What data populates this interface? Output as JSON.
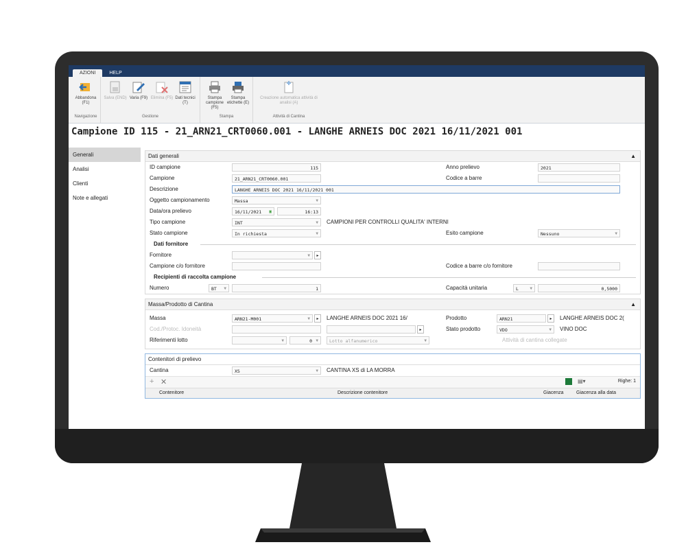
{
  "ribbon": {
    "tabs": [
      "AZIONI",
      "HELP"
    ],
    "groups": [
      {
        "name": "Navigazione",
        "buttons": [
          {
            "label": "Abbandona (F1)",
            "icon": "exit-arrow-icon"
          }
        ]
      },
      {
        "name": "Gestione",
        "buttons": [
          {
            "label": "Salva (END)",
            "icon": "save-icon"
          },
          {
            "label": "Varia (F9)",
            "icon": "edit-icon"
          },
          {
            "label": "Elimina (F5)",
            "icon": "delete-icon"
          },
          {
            "label": "Dati tecnici (T)",
            "icon": "technical-data-icon"
          }
        ]
      },
      {
        "name": "Stampa",
        "buttons": [
          {
            "label": "Stampa campione (F5)",
            "icon": "print-icon"
          },
          {
            "label": "Stampa etichette (E)",
            "icon": "print-labels-icon"
          }
        ]
      },
      {
        "name": "Attività di Cantina",
        "buttons": [
          {
            "label": "Creazione automatica attività di analisi (A)",
            "icon": "auto-create-icon"
          }
        ]
      }
    ]
  },
  "title": "Campione  ID 115 - 21_ARN21_CRT0060.001 - LANGHE ARNEIS DOC 2021 16/11/2021 001",
  "nav": [
    "Generali",
    "Analisi",
    "Clienti",
    "Note e allegati"
  ],
  "dati_generali": {
    "header": "Dati generali",
    "id_label": "ID campione",
    "id_value": "115",
    "anno_label": "Anno prelievo",
    "anno_value": "2021",
    "campione_label": "Campione",
    "campione_value": "21_ARN21_CRT0060.001",
    "barcode_label": "Codice a barre",
    "barcode_value": "",
    "descr_label": "Descrizione",
    "descr_value": "LANGHE ARNEIS DOC 2021 16/11/2021 001",
    "oggetto_label": "Oggetto campionamento",
    "oggetto_value": "Massa",
    "data_label": "Data/ora prelievo",
    "data_value": "16/11/2021",
    "ora_value": "16:13",
    "tipo_label": "Tipo campione",
    "tipo_value": "INT",
    "tipo_desc": "CAMPIONI PER CONTROLLI QUALITA' INTERNI",
    "stato_label": "Stato campione",
    "stato_value": "In richiesta",
    "esito_label": "Esito campione",
    "esito_value": "Nessuno",
    "fornitore_section": "Dati fornitore",
    "fornitore_label": "Fornitore",
    "fornitore_value": "",
    "campione_forn_label": "Campione c/o fornitore",
    "campione_forn_value": "",
    "barcode_forn_label": "Codice a barre c/o fornitore",
    "barcode_forn_value": "",
    "recipienti_section": "Recipienti di raccolta campione",
    "numero_label": "Numero",
    "numero_unit": "BT",
    "numero_value": "1",
    "capacita_label": "Capacità unitaria",
    "capacita_unit": "L",
    "capacita_value": "0,5000"
  },
  "massa": {
    "header": "Massa/Prodotto di Cantina",
    "massa_label": "Massa",
    "massa_value": "ARN21-M001",
    "massa_desc": "LANGHE ARNEIS DOC 2021 16/",
    "prodotto_label": "Prodotto",
    "prodotto_value": "ARN21",
    "prodotto_desc": "LANGHE ARNEIS DOC 2(",
    "cod_label": "Cod./Protoc. Idoneità",
    "cod_value": "",
    "stato_prod_label": "Stato prodotto",
    "stato_prod_value": "VDO",
    "stato_prod_desc": "VINO DOC",
    "rif_label": "Riferimenti lotto",
    "rif_value": "",
    "rif_num": "0",
    "lotto_value": "Lotto alfanumerico",
    "attivita_label": "Attività di cantina collegate"
  },
  "contenitori": {
    "header": "Contenitori di prelievo",
    "cantina_label": "Cantina",
    "cantina_value": "XS",
    "cantina_desc": "CANTINA XS di LA MORRA",
    "righe": "Righe: 1",
    "col_contenitore": "Contenitore",
    "col_descrizione": "Descrizione contenitore",
    "col_giacenza": "Giacenza",
    "col_giacenza_data": "Giacenza alla data"
  },
  "colors": {
    "ribbon_tabs": "#1e3a63",
    "bezel": "#2d2d2d",
    "accent": "#2f6fb3"
  }
}
